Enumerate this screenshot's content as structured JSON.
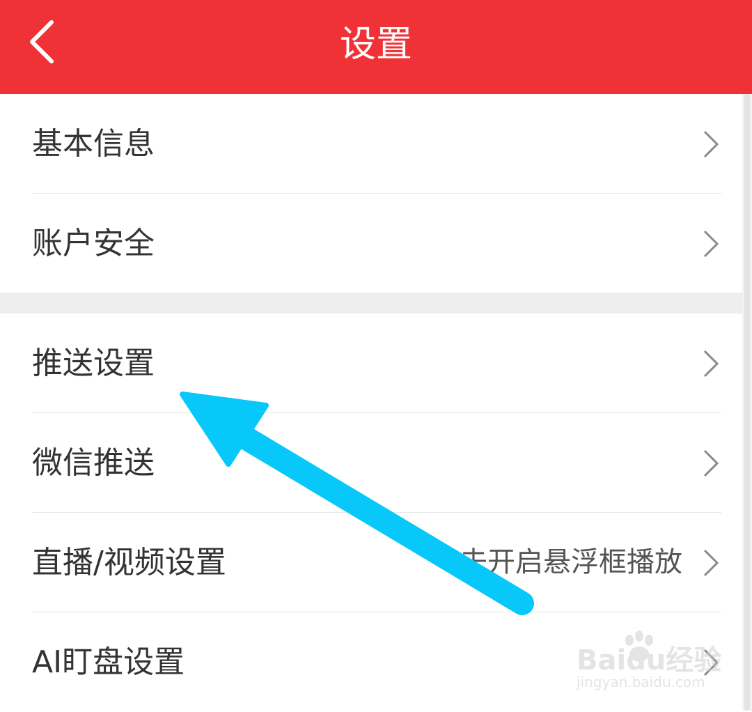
{
  "header": {
    "title": "设置",
    "back_icon": "chevron-left-icon"
  },
  "colors": {
    "header_bg": "#f03237",
    "annotation_arrow": "#08c8fa"
  },
  "groups": [
    {
      "items": [
        {
          "label": "基本信息",
          "value": ""
        },
        {
          "label": "账户安全",
          "value": ""
        }
      ]
    },
    {
      "items": [
        {
          "label": "推送设置",
          "value": ""
        },
        {
          "label": "微信推送",
          "value": ""
        },
        {
          "label": "直播/视频设置",
          "value": "去开启悬浮框播放"
        },
        {
          "label": "AI盯盘设置",
          "value": ""
        }
      ]
    }
  ],
  "watermark": {
    "brand": "Baidu经验",
    "url": "jingyan.baidu.com"
  }
}
